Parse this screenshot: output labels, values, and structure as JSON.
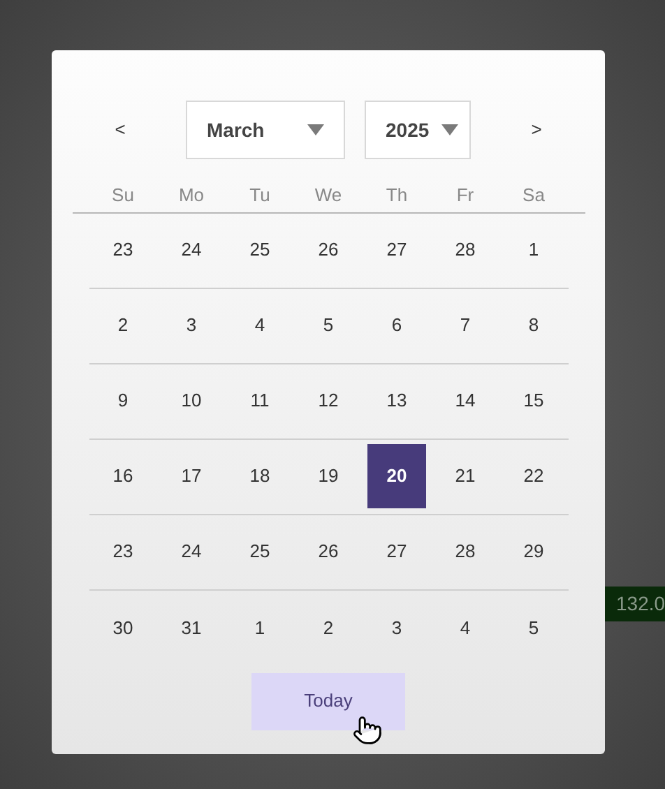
{
  "nav": {
    "previous": "<",
    "next": ">"
  },
  "month_select": {
    "value": "March"
  },
  "year_select": {
    "value": "2025"
  },
  "weekdays": [
    "Su",
    "Mo",
    "Tu",
    "We",
    "Th",
    "Fr",
    "Sa"
  ],
  "weeks": [
    [
      {
        "day": "23",
        "selected": false
      },
      {
        "day": "24",
        "selected": false
      },
      {
        "day": "25",
        "selected": false
      },
      {
        "day": "26",
        "selected": false
      },
      {
        "day": "27",
        "selected": false
      },
      {
        "day": "28",
        "selected": false
      },
      {
        "day": "1",
        "selected": false
      }
    ],
    [
      {
        "day": "2",
        "selected": false
      },
      {
        "day": "3",
        "selected": false
      },
      {
        "day": "4",
        "selected": false
      },
      {
        "day": "5",
        "selected": false
      },
      {
        "day": "6",
        "selected": false
      },
      {
        "day": "7",
        "selected": false
      },
      {
        "day": "8",
        "selected": false
      }
    ],
    [
      {
        "day": "9",
        "selected": false
      },
      {
        "day": "10",
        "selected": false
      },
      {
        "day": "11",
        "selected": false
      },
      {
        "day": "12",
        "selected": false
      },
      {
        "day": "13",
        "selected": false
      },
      {
        "day": "14",
        "selected": false
      },
      {
        "day": "15",
        "selected": false
      }
    ],
    [
      {
        "day": "16",
        "selected": false
      },
      {
        "day": "17",
        "selected": false
      },
      {
        "day": "18",
        "selected": false
      },
      {
        "day": "19",
        "selected": false
      },
      {
        "day": "20",
        "selected": true
      },
      {
        "day": "21",
        "selected": false
      },
      {
        "day": "22",
        "selected": false
      }
    ],
    [
      {
        "day": "23",
        "selected": false
      },
      {
        "day": "24",
        "selected": false
      },
      {
        "day": "25",
        "selected": false
      },
      {
        "day": "26",
        "selected": false
      },
      {
        "day": "27",
        "selected": false
      },
      {
        "day": "28",
        "selected": false
      },
      {
        "day": "29",
        "selected": false
      }
    ],
    [
      {
        "day": "30",
        "selected": false
      },
      {
        "day": "31",
        "selected": false
      },
      {
        "day": "1",
        "selected": false
      },
      {
        "day": "2",
        "selected": false
      },
      {
        "day": "3",
        "selected": false
      },
      {
        "day": "4",
        "selected": false
      },
      {
        "day": "5",
        "selected": false
      }
    ]
  ],
  "today_button": "Today",
  "background_badge": "132.0"
}
